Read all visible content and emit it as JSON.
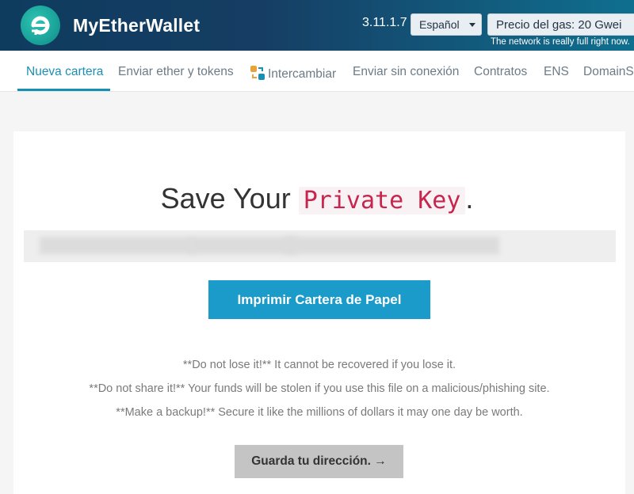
{
  "header": {
    "app_title": "MyEtherWallet",
    "version": "3.11.1.7",
    "language": "Español",
    "gas_price": "Precio del gas: 20 Gwei",
    "gas_note": "The network is really full right now."
  },
  "nav": {
    "items": [
      {
        "label": "Nueva cartera"
      },
      {
        "label": "Enviar ether y tokens"
      },
      {
        "label": "Intercambiar"
      },
      {
        "label": "Enviar sin conexión"
      },
      {
        "label": "Contratos"
      },
      {
        "label": "ENS"
      },
      {
        "label": "DomainSale"
      }
    ]
  },
  "main": {
    "title_prefix": "Save Your",
    "title_key": "Private Key",
    "title_suffix": ".",
    "print_button": "Imprimir Cartera de Papel",
    "warnings": [
      "**Do not lose it!** It cannot be recovered if you lose it.",
      "**Do not share it!** Your funds will be stolen if you use this file on a malicious/phishing site.",
      "**Make a backup!** Secure it like the millions of dollars it may one day be worth."
    ],
    "save_button": "Guarda tu dirección. →"
  },
  "colors": {
    "accent": "#1a9bc9",
    "private_key_text": "#c7254e",
    "header_start": "#0e3c5f",
    "header_end": "#0f6f8f"
  }
}
